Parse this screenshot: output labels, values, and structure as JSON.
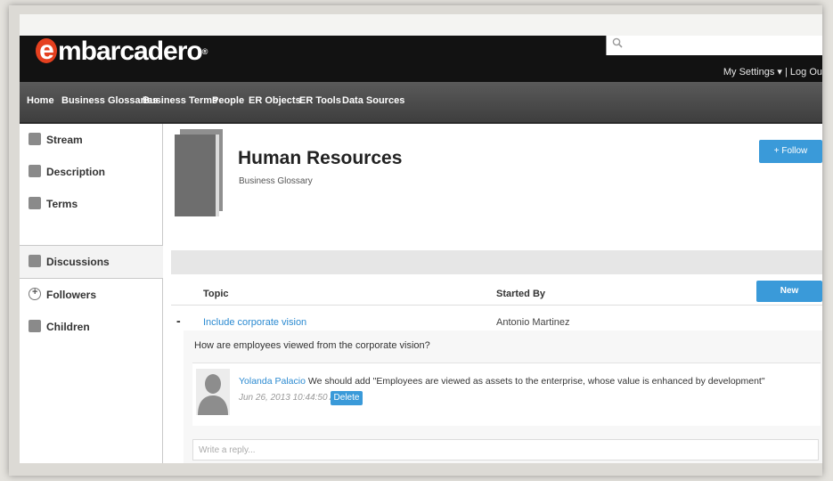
{
  "app": {
    "logo_text": "mbarcadero",
    "logo_letter": "e"
  },
  "search": {
    "placeholder": ""
  },
  "usermenu": {
    "settings_label": "My Settings ▾",
    "separator": " | ",
    "logout_label": "Log Ou"
  },
  "nav": {
    "items": [
      "Home",
      "Business Glossaries",
      "Business Terms",
      "People",
      "ER Objects",
      "ER Tools",
      "Data Sources"
    ]
  },
  "sidebar": {
    "items": [
      {
        "label": "Stream",
        "icon": "stream-icon"
      },
      {
        "label": "Description",
        "icon": "description-icon"
      },
      {
        "label": "Terms",
        "icon": "terms-icon"
      },
      {
        "label": "Discussions",
        "icon": "discussions-icon",
        "active": true
      },
      {
        "label": "Followers",
        "icon": "followers-icon"
      },
      {
        "label": "Children",
        "icon": "children-icon"
      }
    ]
  },
  "main": {
    "title": "Human Resources",
    "subtitle": "Business Glossary",
    "follow_label": "+ Follow",
    "table": {
      "columns": [
        "Topic",
        "Started By"
      ],
      "new_discussion_label": "New Discussion",
      "rows": [
        {
          "collapse_symbol": "-",
          "topic": "Include corporate vision",
          "started_by": "Antonio Martinez",
          "question": "How are employees viewed from the corporate vision?",
          "comment": {
            "author": "Yolanda Palacio",
            "text": " We should add \"Employees are viewed as assets to the enterprise, whose value is enhanced by development\"",
            "date": "Jun 26, 2013 10:44:50 AM",
            "delete_label": "Delete"
          },
          "reply_placeholder": "Write a reply..."
        }
      ]
    }
  },
  "colors": {
    "accent": "#3a9ad9",
    "link": "#2b8ad1",
    "topbar": "#121212",
    "logo_e": "#e5401f"
  }
}
